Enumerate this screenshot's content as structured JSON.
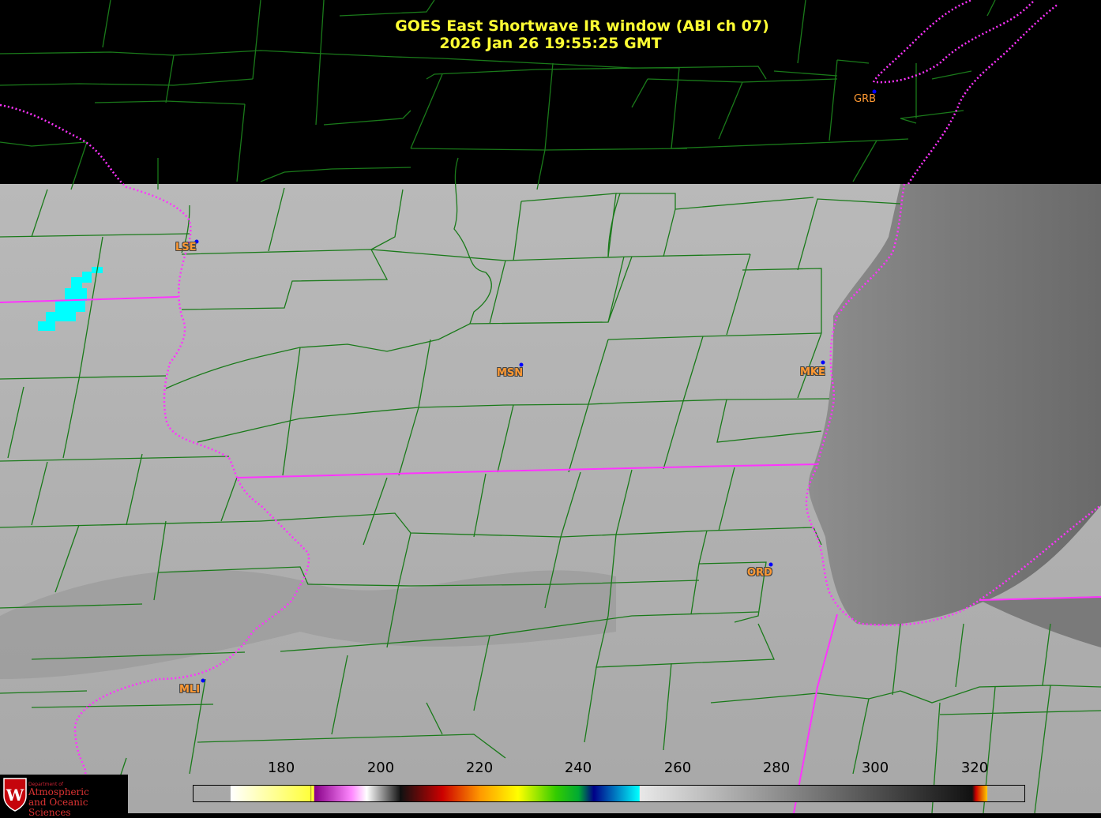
{
  "title": {
    "line1": "GOES East Shortwave IR window (ABI ch 07)",
    "line2": "2026 Jan 26  19:55:25 GMT"
  },
  "stations": [
    {
      "id": "GRB",
      "label": "GRB"
    },
    {
      "id": "LSE",
      "label": "LSE"
    },
    {
      "id": "MSN",
      "label": "MSN"
    },
    {
      "id": "MKE",
      "label": "MKE"
    },
    {
      "id": "ORD",
      "label": "ORD"
    },
    {
      "id": "MLI",
      "label": "MLI"
    }
  ],
  "colorbar": {
    "ticks": [
      "180",
      "200",
      "220",
      "240",
      "260",
      "280",
      "300",
      "320"
    ]
  },
  "logo": {
    "line1": "Department of",
    "line2a": "Atmospheric",
    "line2b": "and Oceanic Sciences",
    "emblem": "W"
  },
  "colors": {
    "title": "#ffff33",
    "state_border": "#ff33ff",
    "county_border": "#1a7a1a",
    "station_label": "#ff9933"
  }
}
